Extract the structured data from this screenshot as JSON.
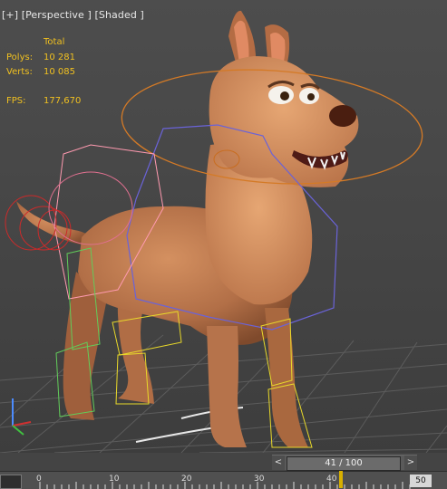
{
  "viewport": {
    "label": "[+] [Perspective ] [Shaded ]",
    "stats": {
      "header": "Total",
      "polys_label": "Polys:",
      "polys_value": "10 281",
      "verts_label": "Verts:",
      "verts_value": "10 085",
      "fps_label": "FPS:",
      "fps_value": "177,670"
    }
  },
  "timeline": {
    "frame_display": "41 / 100",
    "current_frame": 41,
    "total_frames": 100,
    "prev_arrow": "<",
    "next_arrow": ">",
    "ruler_labels": [
      "0",
      "10",
      "20",
      "30",
      "40",
      "50"
    ],
    "current_box": "50"
  },
  "colors": {
    "stats_text": "#f0c020",
    "fur": "#b8754f",
    "rig_orange": "#d47a26",
    "rig_purple": "#6a63d8",
    "rig_yellow": "#e8d82a",
    "rig_green": "#62cc5a",
    "rig_red": "#cc2a2a",
    "rig_pink": "#ff9ab0"
  }
}
